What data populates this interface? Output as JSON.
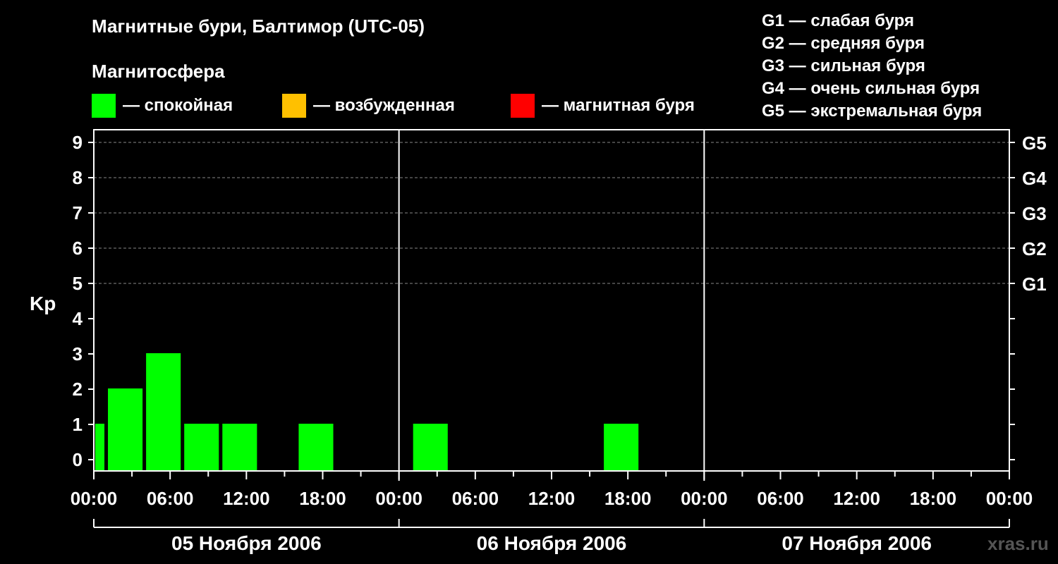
{
  "title": "Магнитные бури, Балтимор (UTC-05)",
  "subtitle": "Магнитосфера",
  "legend": [
    {
      "label": "— спокойная",
      "color": "#00ff00"
    },
    {
      "label": "— возбужденная",
      "color": "#ffc000"
    },
    {
      "label": "— магнитная буря",
      "color": "#ff0000"
    }
  ],
  "g_legend": [
    "G1 — слабая буря",
    "G2 — средняя буря",
    "G3 — сильная буря",
    "G4 — очень сильная буря",
    "G5 — экстремальная буря"
  ],
  "watermark": "xras.ru",
  "chart_data": {
    "type": "bar",
    "ylabel": "Kp",
    "ylim": [
      0,
      9
    ],
    "yticks": [
      "0",
      "1",
      "2",
      "3",
      "4",
      "5",
      "6",
      "7",
      "8",
      "9"
    ],
    "right_axis_labels": [
      {
        "value": 5,
        "label": "G1"
      },
      {
        "value": 6,
        "label": "G2"
      },
      {
        "value": 7,
        "label": "G3"
      },
      {
        "value": 8,
        "label": "G4"
      },
      {
        "value": 9,
        "label": "G5"
      }
    ],
    "x_range_hours": [
      0,
      72
    ],
    "xtick_labels": [
      "00:00",
      "06:00",
      "12:00",
      "18:00",
      "00:00",
      "06:00",
      "12:00",
      "18:00",
      "00:00",
      "06:00",
      "12:00",
      "18:00",
      "00:00"
    ],
    "days": [
      "05 Ноября 2006",
      "06 Ноября 2006",
      "07 Ноября 2006"
    ],
    "grid": true,
    "bars": [
      {
        "start": 0,
        "end": 1,
        "value": 1,
        "color": "#00ff00"
      },
      {
        "start": 1,
        "end": 4,
        "value": 2,
        "color": "#00ff00"
      },
      {
        "start": 4,
        "end": 7,
        "value": 3,
        "color": "#00ff00"
      },
      {
        "start": 7,
        "end": 10,
        "value": 1,
        "color": "#00ff00"
      },
      {
        "start": 10,
        "end": 13,
        "value": 1,
        "color": "#00ff00"
      },
      {
        "start": 16,
        "end": 19,
        "value": 1,
        "color": "#00ff00"
      },
      {
        "start": 25,
        "end": 28,
        "value": 1,
        "color": "#00ff00"
      },
      {
        "start": 40,
        "end": 43,
        "value": 1,
        "color": "#00ff00"
      }
    ]
  }
}
